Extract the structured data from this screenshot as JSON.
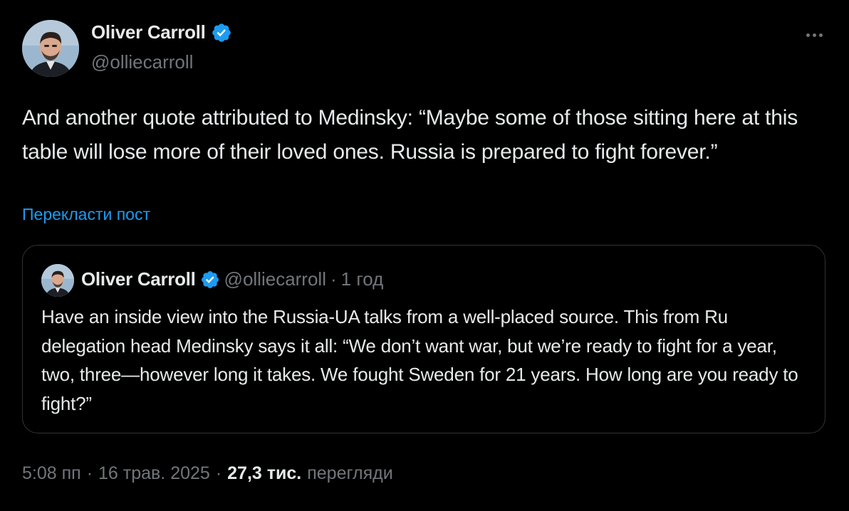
{
  "author": {
    "display_name": "Oliver Carroll",
    "handle": "@olliecarroll",
    "verified": true,
    "verified_color": "#1d9bf0"
  },
  "post": {
    "text": "And another quote attributed to Medinsky: “Maybe some of those sitting here at this table will lose more of their loved ones. Russia is prepared to fight forever.”",
    "translate_label": "Перекласти пост"
  },
  "quoted_post": {
    "display_name": "Oliver Carroll",
    "handle": "@olliecarroll",
    "separator": "·",
    "time": "1 год",
    "text": "Have an inside view into the Russia-UA talks from a well-placed source. This from Ru delegation head Medinsky says it all: “We don’t want war, but we’re ready to fight for a year, two, three—however long it takes. We fought Sweden for 21 years. How long are you ready to fight?”"
  },
  "meta": {
    "time": "5:08 пп",
    "sep1": "·",
    "date": "16 трав. 2025",
    "sep2": "·",
    "views_count": "27,3 тис.",
    "views_label": "перегляди"
  },
  "icons": {
    "more": "more-horizontal-icon",
    "verified": "verified-badge-icon"
  },
  "colors": {
    "background": "#000000",
    "text_primary": "#e7e9ea",
    "text_secondary": "#71767b",
    "accent": "#1d9bf0",
    "border": "#2f3336"
  }
}
